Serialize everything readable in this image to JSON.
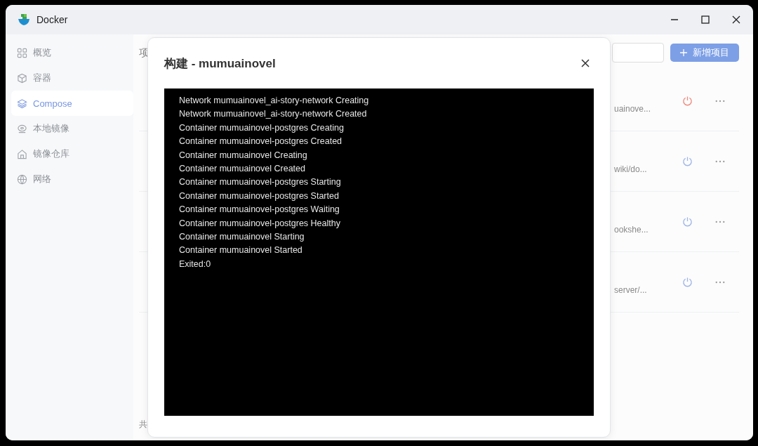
{
  "window": {
    "title": "Docker"
  },
  "sidebar": {
    "items": [
      {
        "label": "概览",
        "selected": false
      },
      {
        "label": "容器",
        "selected": false
      },
      {
        "label": "Compose",
        "selected": true
      },
      {
        "label": "本地镜像",
        "selected": false
      },
      {
        "label": "镜像仓库",
        "selected": false
      },
      {
        "label": "网络",
        "selected": false
      }
    ]
  },
  "page": {
    "heading": "项",
    "add_button": "新增项目",
    "footer": "共",
    "rows": [
      {
        "path": "uainove...",
        "running": true
      },
      {
        "path": "wiki/do...",
        "running": false
      },
      {
        "path": "ookshe...",
        "running": false
      },
      {
        "path": "server/...",
        "running": false
      }
    ]
  },
  "dialog": {
    "title": "构建 - mumuainovel",
    "log": [
      "Network mumuainovel_ai-story-network Creating",
      "Network mumuainovel_ai-story-network Created",
      "Container mumuainovel-postgres Creating",
      "Container mumuainovel-postgres Created",
      "Container mumuainovel Creating",
      "Container mumuainovel Created",
      "Container mumuainovel-postgres Starting",
      "Container mumuainovel-postgres Started",
      "Container mumuainovel-postgres Waiting",
      "Container mumuainovel-postgres Healthy",
      "Container mumuainovel Starting",
      "Container mumuainovel Started",
      "Exited:0"
    ]
  }
}
